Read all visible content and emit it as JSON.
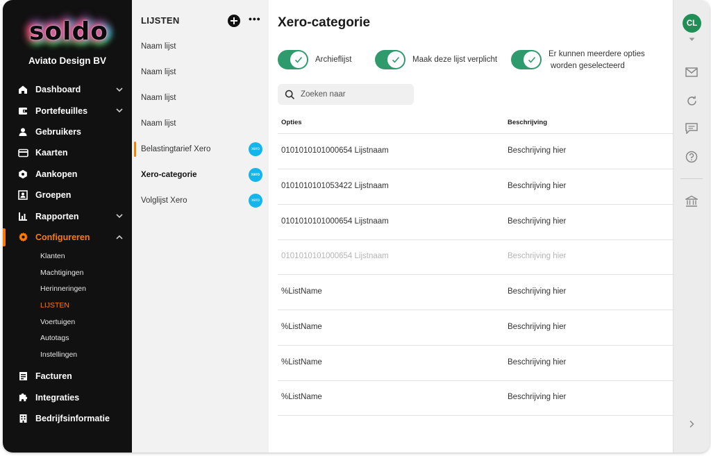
{
  "brand": {
    "logo_text": "soldo",
    "company": "Aviato Design BV"
  },
  "nav": {
    "items": [
      {
        "label": "Dashboard",
        "icon": "home-icon",
        "has_chevron": true
      },
      {
        "label": "Portefeuilles",
        "icon": "wallet-icon",
        "has_chevron": true
      },
      {
        "label": "Gebruikers",
        "icon": "user-icon"
      },
      {
        "label": "Kaarten",
        "icon": "card-icon"
      },
      {
        "label": "Aankopen",
        "icon": "purchase-icon"
      },
      {
        "label": "Groepen",
        "icon": "group-icon"
      },
      {
        "label": "Rapporten",
        "icon": "chart-icon",
        "has_chevron": true
      },
      {
        "label": "Configureren",
        "icon": "gear-icon",
        "has_chevron": true,
        "active": true
      }
    ],
    "sub_items": [
      "Klanten",
      "Machtigingen",
      "Herinneringen",
      "LIJSTEN",
      "Voertuigen",
      "Autotags",
      "Instellingen"
    ],
    "active_sub": "LIJSTEN",
    "lower_items": [
      {
        "label": "Facturen",
        "icon": "invoice-icon"
      },
      {
        "label": "Integraties",
        "icon": "puzzle-icon"
      },
      {
        "label": "Bedrijfsinformatie",
        "icon": "building-icon"
      }
    ],
    "accent_color": "#ff7a00"
  },
  "lists": {
    "title": "LIJSTEN",
    "items": [
      {
        "label": "Naam lijst"
      },
      {
        "label": "Naam lijst"
      },
      {
        "label": "Naam lijst"
      },
      {
        "label": "Naam lijst"
      },
      {
        "label": "Belastingtarief Xero",
        "xero": true,
        "marked": true
      },
      {
        "label": "Xero-categorie",
        "xero": true,
        "selected": true
      },
      {
        "label": "Volglijst Xero",
        "xero": true
      }
    ],
    "xero_badge_text": "xero"
  },
  "main": {
    "title": "Xero-categorie",
    "toggles": [
      {
        "label": "Archieflijst",
        "on": true
      },
      {
        "label": "Maak deze lijst verplicht",
        "on": true
      },
      {
        "label_line1": "Er kunnen meerdere opties",
        "label_line2": "worden geselecteerd",
        "on": true
      }
    ],
    "search": {
      "placeholder": "Zoeken naar"
    },
    "columns": [
      "Opties",
      "Beschrijving"
    ],
    "rows": [
      {
        "option": "0101010101000654 Lijstnaam",
        "description": "Beschrijving hier",
        "archived": false
      },
      {
        "option": "0101010101053422 Lijstnaam",
        "description": "Beschrijving hier",
        "archived": false
      },
      {
        "option": "0101010101000654 Lijstnaam",
        "description": "Beschrijving hier",
        "archived": false
      },
      {
        "option": "0101010101000654 Lijstnaam",
        "description": "Beschrijving hier",
        "archived": true
      },
      {
        "option": "%ListName",
        "description": "Beschrijving hier",
        "archived": false
      },
      {
        "option": "%ListName",
        "description": "Beschrijving hier",
        "archived": false
      },
      {
        "option": "%ListName",
        "description": "Beschrijving hier",
        "archived": false
      },
      {
        "option": "%ListName",
        "description": "Beschrijving hier",
        "archived": false
      }
    ],
    "toggle_color": "#2f9b6c"
  },
  "rail": {
    "avatar_initials": "CL",
    "avatar_color": "#1f8f55",
    "icons": [
      "mail-icon",
      "refresh-icon",
      "chat-icon",
      "help-icon",
      "bank-icon",
      "chevron-right-icon"
    ]
  }
}
